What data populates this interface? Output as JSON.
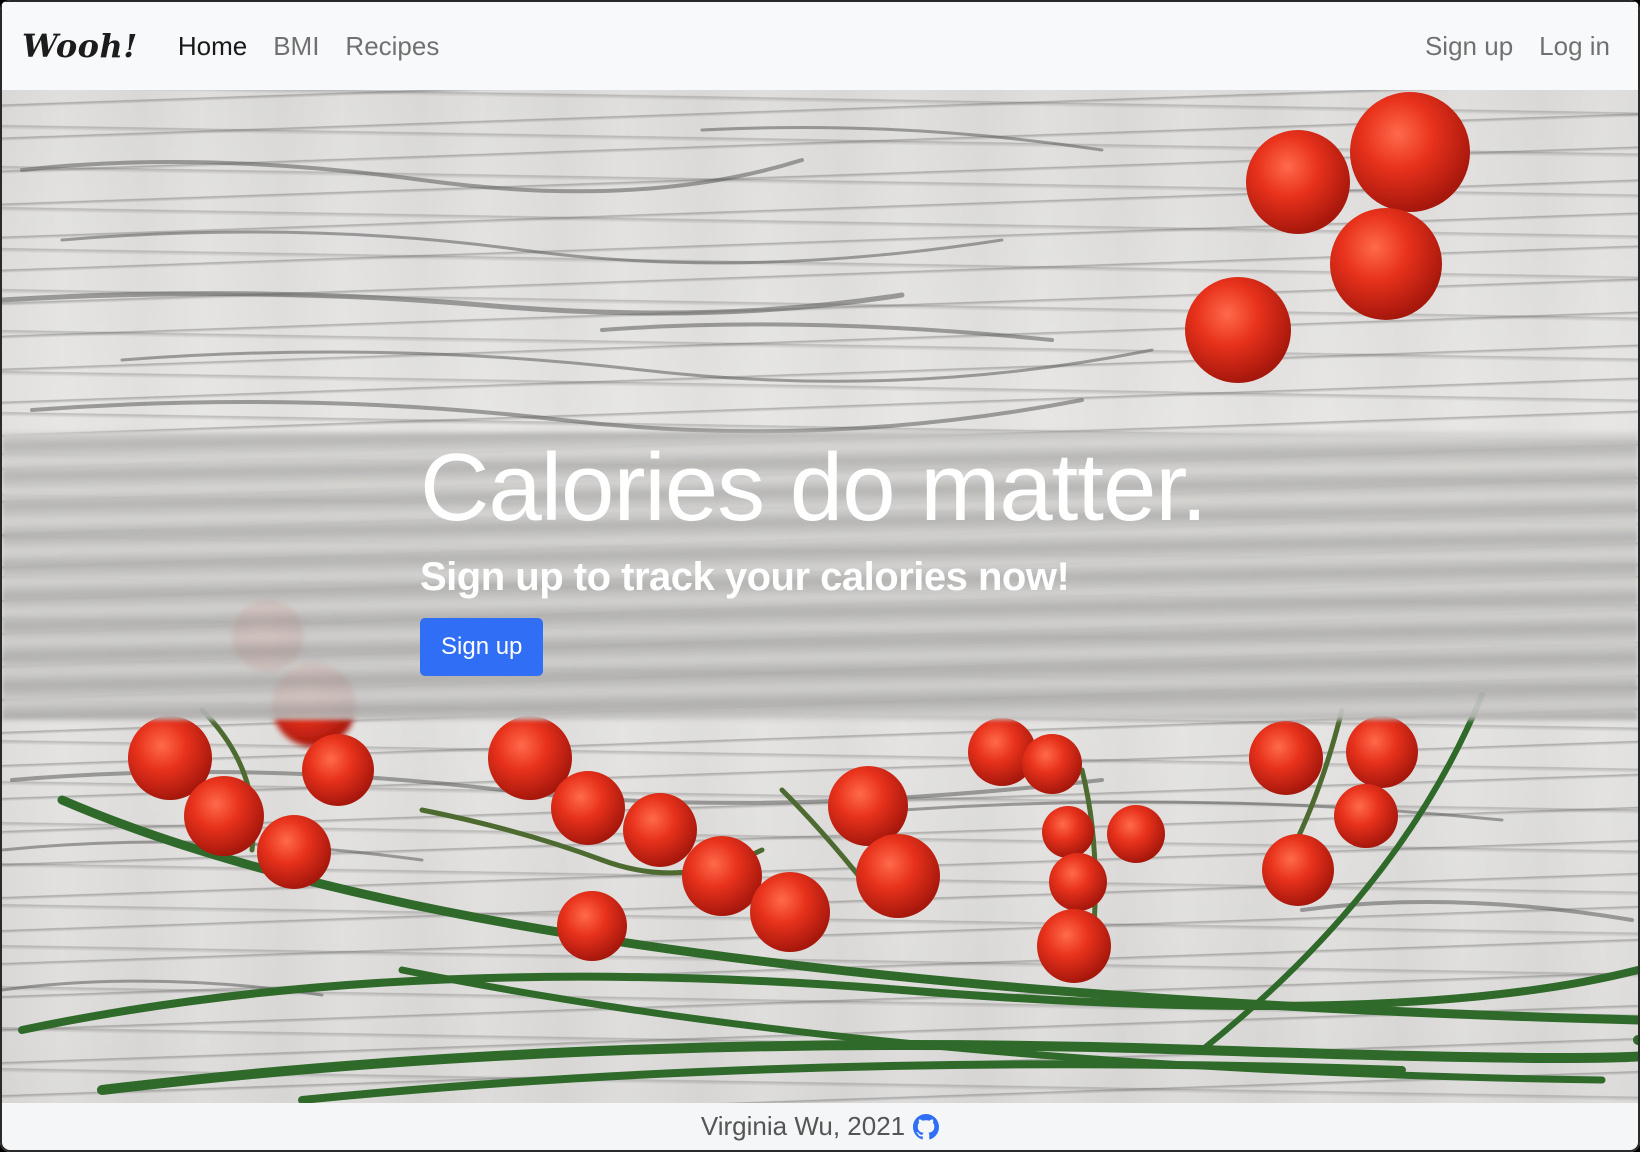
{
  "navbar": {
    "brand": "Wooh!",
    "links": [
      {
        "label": "Home",
        "active": true
      },
      {
        "label": "BMI",
        "active": false
      },
      {
        "label": "Recipes",
        "active": false
      }
    ],
    "right_links": [
      {
        "label": "Sign up"
      },
      {
        "label": "Log in"
      }
    ]
  },
  "hero": {
    "title": "Calories do matter.",
    "subtitle": "Sign up to track your calories now!",
    "cta_label": "Sign up",
    "cta_color": "#2f6ef5"
  },
  "footer": {
    "credit": "Virginia Wu, 2021",
    "icon": "github-icon"
  }
}
